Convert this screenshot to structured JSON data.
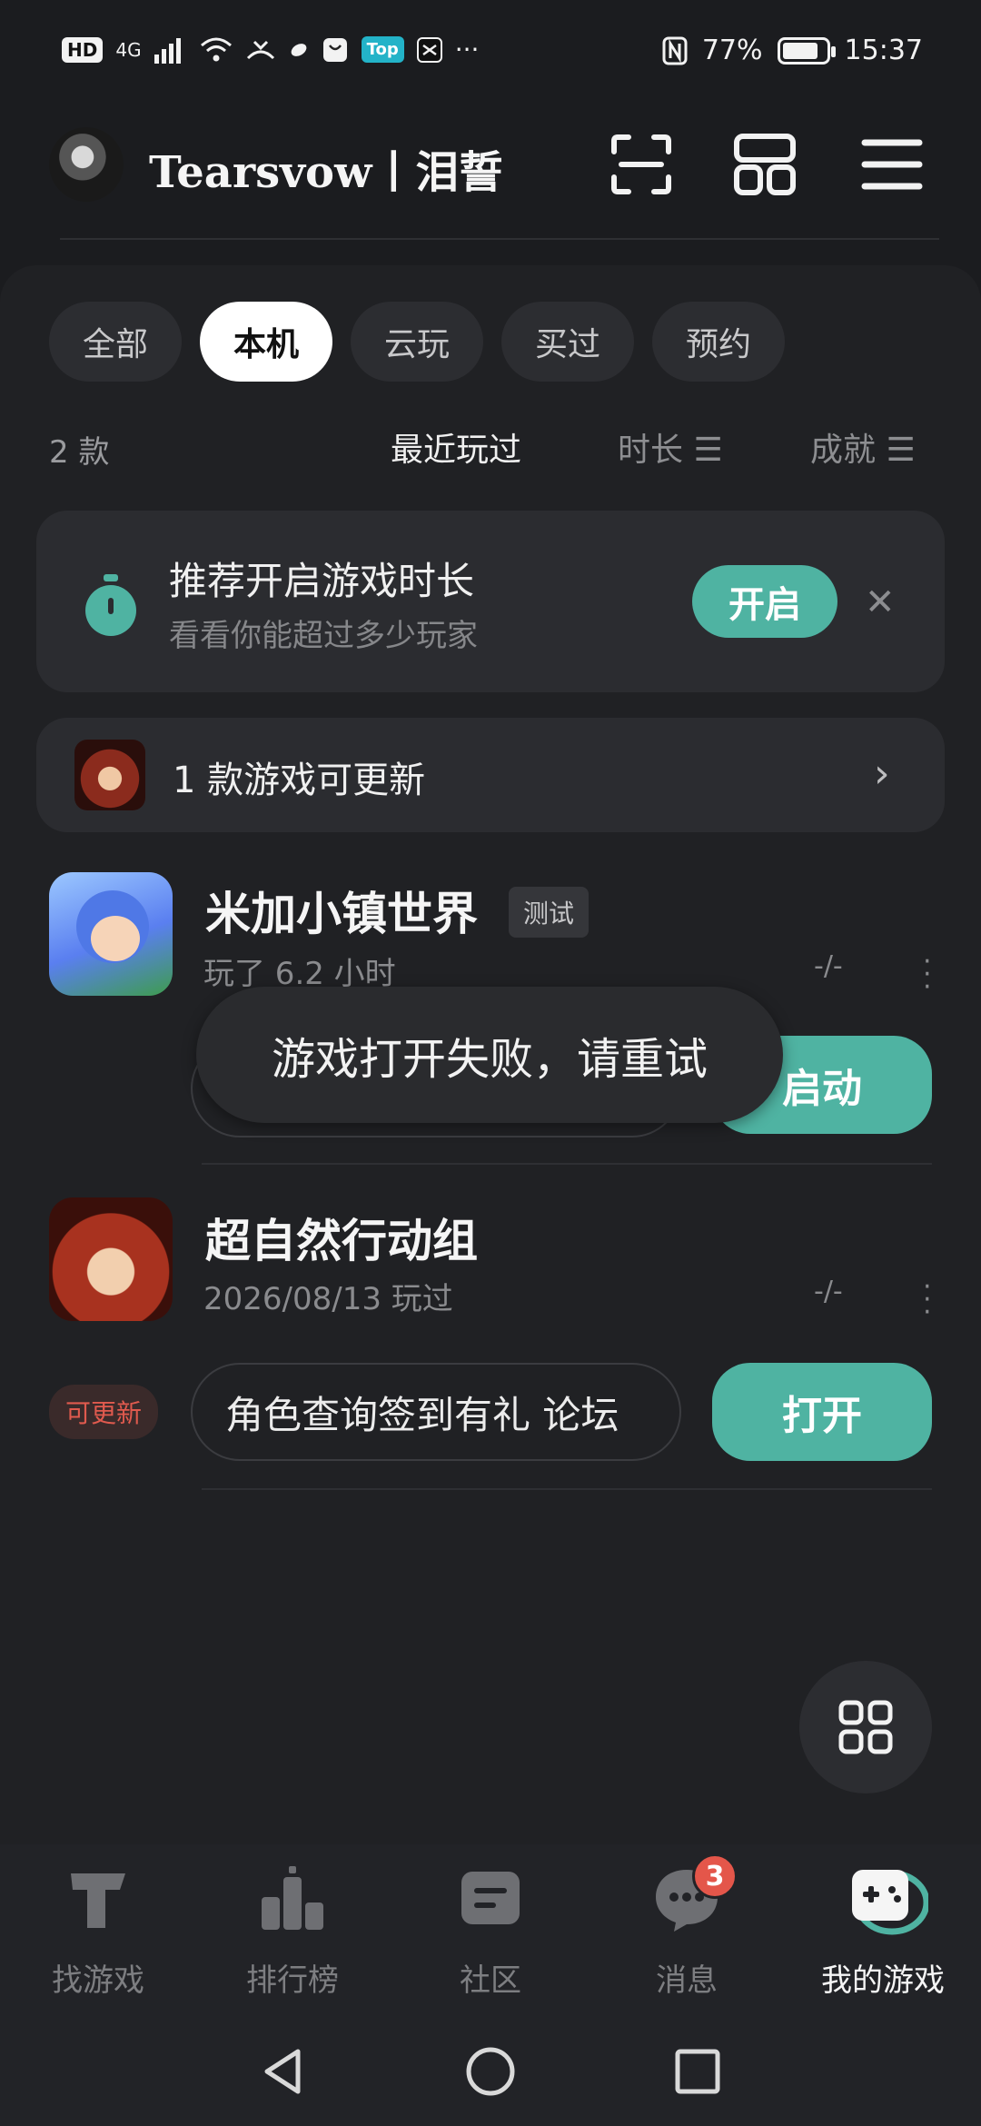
{
  "status_bar": {
    "left_items": [
      "HD",
      "4G",
      "Top",
      "···"
    ],
    "battery": "77%",
    "time": "15:37"
  },
  "header": {
    "username": "Tearsvow丨泪誓",
    "icons": [
      "scan-icon",
      "grid-layout-icon",
      "menu-icon"
    ]
  },
  "filters": [
    {
      "label": "全部",
      "active": false
    },
    {
      "label": "本机",
      "active": true
    },
    {
      "label": "云玩",
      "active": false
    },
    {
      "label": "买过",
      "active": false
    },
    {
      "label": "预约",
      "active": false
    }
  ],
  "list_header": {
    "count": "2 款",
    "sort_options": [
      "最近玩过",
      "时长 ☰",
      "成就 ☰"
    ]
  },
  "recommend_card": {
    "title": "推荐开启游戏时长",
    "subtitle": "看看你能超过多少玩家",
    "button": "开启",
    "close": "✕"
  },
  "update_card": {
    "text": "1 款游戏可更新",
    "chevron": "›"
  },
  "games": [
    {
      "title": "米加小镇世界",
      "tag": "测试",
      "subtitle": "玩了 6.2 小时",
      "dash": "-/-",
      "button": "启动"
    },
    {
      "title": "超自然行动组",
      "subtitle": "2026/08/13 玩过",
      "dash": "-/-",
      "update_badge": "可更新",
      "links": "角色查询签到有礼 论坛",
      "button": "打开"
    }
  ],
  "toast": "游戏打开失败，请重试",
  "bottom_nav": [
    {
      "label": "找游戏",
      "icon": "find-games-icon"
    },
    {
      "label": "排行榜",
      "icon": "leaderboard-icon"
    },
    {
      "label": "社区",
      "icon": "community-icon"
    },
    {
      "label": "消息",
      "icon": "message-icon",
      "badge": "3"
    },
    {
      "label": "我的游戏",
      "icon": "my-games-icon",
      "active": true
    }
  ],
  "colors": {
    "accent": "#4fb3a2",
    "background": "#1b1c1f",
    "panel": "#202124",
    "badge": "#e4564a"
  }
}
